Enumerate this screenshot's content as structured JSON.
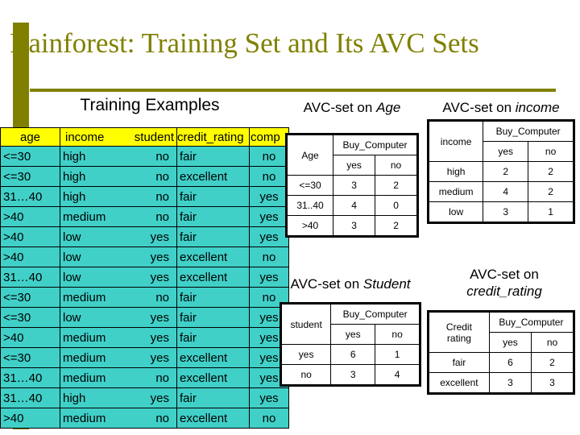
{
  "slide": {
    "title": "Rainforest:  Training Set and Its AVC Sets",
    "accent_color": "#808000",
    "header_fill": "#ffff00",
    "cell_fill": "#40d0c8"
  },
  "training": {
    "heading": "Training Examples",
    "columns": [
      "age",
      "income",
      "student",
      "credit_rating",
      "comp"
    ],
    "rows": [
      {
        "age": "<=30",
        "income": "high",
        "student": "no",
        "credit_rating": "fair",
        "buys": "no"
      },
      {
        "age": "<=30",
        "income": "high",
        "student": "no",
        "credit_rating": "excellent",
        "buys": "no"
      },
      {
        "age": "31…40",
        "income": "high",
        "student": "no",
        "credit_rating": "fair",
        "buys": "yes"
      },
      {
        "age": ">40",
        "income": "medium",
        "student": "no",
        "credit_rating": "fair",
        "buys": "yes"
      },
      {
        "age": ">40",
        "income": "low",
        "student": "yes",
        "credit_rating": "fair",
        "buys": "yes"
      },
      {
        "age": ">40",
        "income": "low",
        "student": "yes",
        "credit_rating": "excellent",
        "buys": "no"
      },
      {
        "age": "31…40",
        "income": "low",
        "student": "yes",
        "credit_rating": "excellent",
        "buys": "yes"
      },
      {
        "age": "<=30",
        "income": "medium",
        "student": "no",
        "credit_rating": "fair",
        "buys": "no"
      },
      {
        "age": "<=30",
        "income": "low",
        "student": "yes",
        "credit_rating": "fair",
        "buys": "yes"
      },
      {
        "age": ">40",
        "income": "medium",
        "student": "yes",
        "credit_rating": "fair",
        "buys": "yes"
      },
      {
        "age": "<=30",
        "income": "medium",
        "student": "yes",
        "credit_rating": "excellent",
        "buys": "yes"
      },
      {
        "age": "31…40",
        "income": "medium",
        "student": "no",
        "credit_rating": "excellent",
        "buys": "yes"
      },
      {
        "age": "31…40",
        "income": "high",
        "student": "yes",
        "credit_rating": "fair",
        "buys": "yes"
      },
      {
        "age": ">40",
        "income": "medium",
        "student": "no",
        "credit_rating": "excellent",
        "buys": "no"
      }
    ]
  },
  "avc_age": {
    "heading_prefix": "AVC-set on ",
    "heading_attr": "Age",
    "key_header": "Age",
    "group_header": "Buy_Computer",
    "yes_header": "yes",
    "no_header": "no",
    "rows": [
      {
        "key": "<=30",
        "yes": "3",
        "no": "2"
      },
      {
        "key": "31..40",
        "yes": "4",
        "no": "0"
      },
      {
        "key": ">40",
        "yes": "3",
        "no": "2"
      }
    ]
  },
  "avc_income": {
    "heading_prefix": "AVC-set on ",
    "heading_attr": "income",
    "key_header": "income",
    "group_header": "Buy_Computer",
    "yes_header": "yes",
    "no_header": "no",
    "rows": [
      {
        "key": "high",
        "yes": "2",
        "no": "2"
      },
      {
        "key": "medium",
        "yes": "4",
        "no": "2"
      },
      {
        "key": "low",
        "yes": "3",
        "no": "1"
      }
    ]
  },
  "avc_student": {
    "heading_prefix": "AVC-set on ",
    "heading_attr": "Student",
    "key_header": "student",
    "group_header": "Buy_Computer",
    "yes_header": "yes",
    "no_header": "no",
    "rows": [
      {
        "key": "yes",
        "yes": "6",
        "no": "1"
      },
      {
        "key": "no",
        "yes": "3",
        "no": "4"
      }
    ]
  },
  "avc_credit": {
    "heading_prefix": "AVC-set on",
    "heading_attr": "credit_rating",
    "key_header_line1": "Credit",
    "key_header_line2": "rating",
    "group_header": "Buy_Computer",
    "yes_header": "yes",
    "no_header": "no",
    "rows": [
      {
        "key": "fair",
        "yes": "6",
        "no": "2"
      },
      {
        "key": "excellent",
        "yes": "3",
        "no": "3"
      }
    ]
  }
}
